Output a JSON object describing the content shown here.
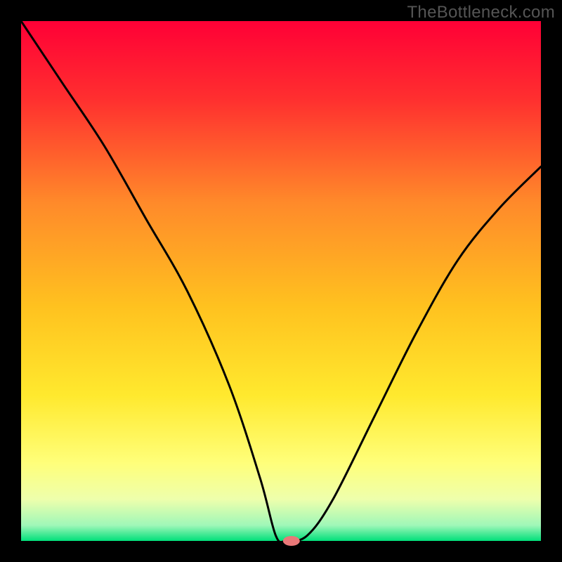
{
  "watermark": "TheBottleneck.com",
  "chart_data": {
    "type": "line",
    "title": "",
    "xlabel": "",
    "ylabel": "",
    "xlim": [
      0,
      100
    ],
    "ylim": [
      0,
      100
    ],
    "grid": false,
    "legend": false,
    "background_gradient": [
      "#ff0033",
      "#ff6a2a",
      "#ffd200",
      "#ffff66",
      "#e6ff99",
      "#00e079"
    ],
    "series": [
      {
        "name": "bottleneck-curve",
        "x": [
          0,
          8,
          16,
          24,
          32,
          40,
          46,
          49,
          51,
          55,
          60,
          68,
          76,
          84,
          92,
          100
        ],
        "y": [
          100,
          88,
          76,
          62,
          48,
          30,
          12,
          1,
          0,
          1,
          8,
          24,
          40,
          54,
          64,
          72
        ]
      }
    ],
    "marker": {
      "x": 52,
      "y": 0,
      "color": "#e97878",
      "rx": 12,
      "ry": 7
    }
  }
}
